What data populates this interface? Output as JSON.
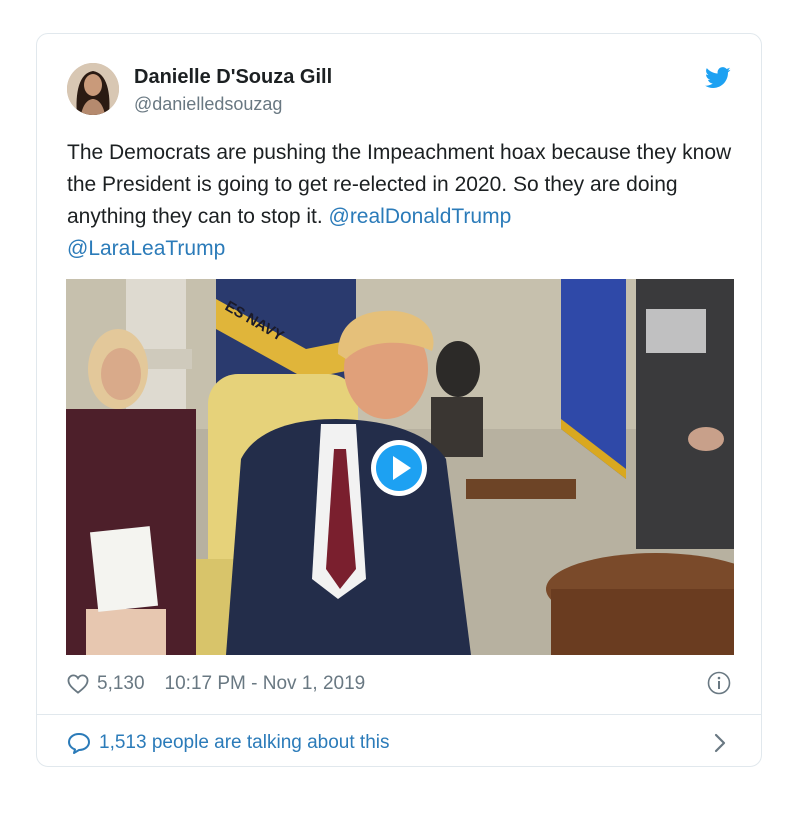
{
  "author": {
    "name": "Danielle D'Souza Gill",
    "handle": "@danielledsouzag"
  },
  "tweet": {
    "text_parts": [
      "The Democrats are pushing the Impeachment hoax because they know the President is going to get re-elected in 2020. So they are doing anything they can to stop it. ",
      "@realDonaldTrump",
      "@LaraLeaTrump"
    ]
  },
  "media": {
    "flag_text": "ES NAVY",
    "play_icon": "play-circle-icon"
  },
  "footer": {
    "likes": "5,130",
    "timestamp": "10:17 PM - Nov 1, 2019",
    "talking": "1,513 people are talking about this"
  },
  "icons": {
    "brand": "twitter-bird-icon",
    "heart": "heart-icon",
    "info": "info-icon",
    "comment": "comment-bubble-icon",
    "chevron": "chevron-right-icon"
  },
  "colors": {
    "link": "#2b7bb9",
    "twitter_blue": "#1da1f2",
    "text": "#1c2022",
    "muted": "#697882",
    "border": "#e1e8ed"
  }
}
